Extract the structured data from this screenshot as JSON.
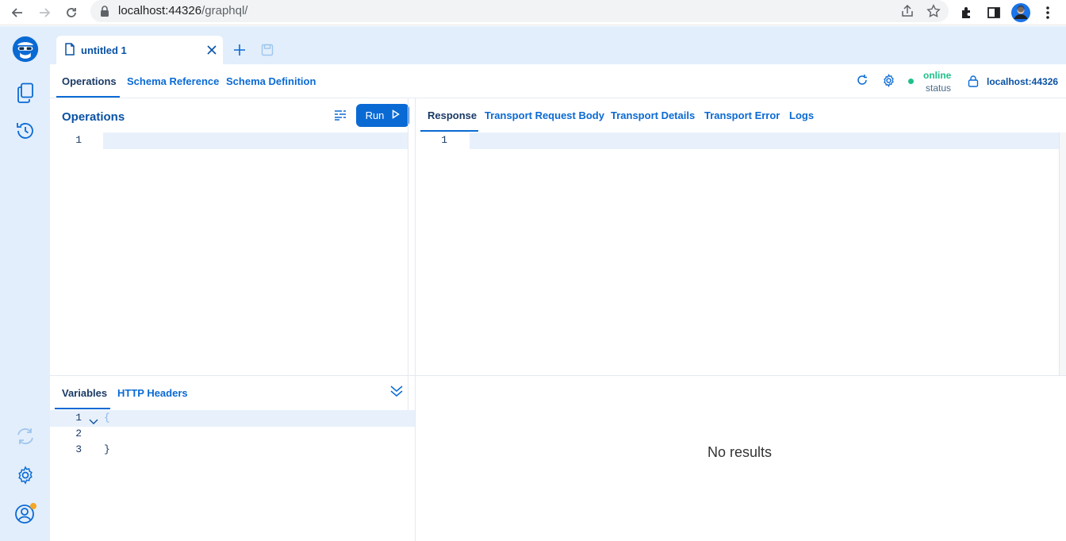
{
  "browser": {
    "url_host": "localhost:44326",
    "url_path": "/graphql/"
  },
  "tabs": [
    {
      "label": "untitled 1"
    }
  ],
  "toolbar": {
    "tabs": [
      "Operations",
      "Schema Reference",
      "Schema Definition"
    ],
    "status_value": "online",
    "status_label": "status",
    "host": "localhost:44326"
  },
  "operations": {
    "title": "Operations",
    "run_label": "Run",
    "lines": [
      "1"
    ]
  },
  "response": {
    "tabs": [
      "Response",
      "Transport Request Body",
      "Transport Details",
      "Transport Error",
      "Logs"
    ],
    "lines": [
      "1"
    ],
    "empty_text": "No results"
  },
  "variables": {
    "tabs": [
      "Variables",
      "HTTP Headers"
    ],
    "lines": [
      "1",
      "2",
      "3"
    ],
    "code": [
      "{",
      "",
      "}"
    ]
  },
  "colors": {
    "accent": "#0a6ad4",
    "sidebar_bg": "#e2eefb",
    "online": "#1fc08a",
    "notification": "#f5a623"
  }
}
